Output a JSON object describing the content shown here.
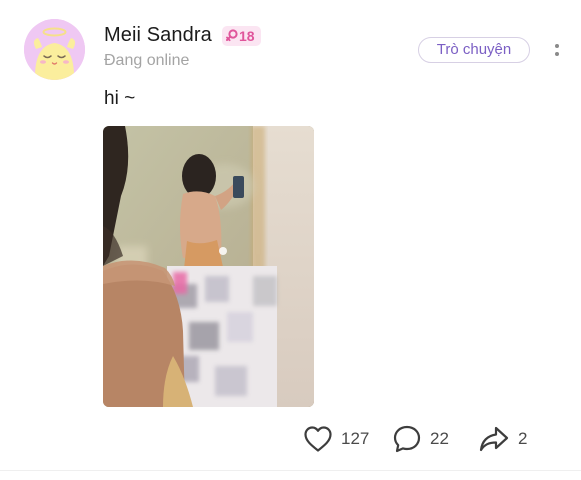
{
  "post": {
    "author": {
      "name": "Meii Sandra",
      "gender_icon": "female-symbol-icon",
      "age_badge": "18",
      "status": "Đang online"
    },
    "chat_button_label": "Trò chuyện",
    "text": "hi ~",
    "actions": {
      "likes": "127",
      "comments": "22",
      "shares": "2"
    }
  },
  "colors": {
    "avatar_bg": "#efc8f3",
    "badge_bg": "#fbe5f2",
    "badge_text": "#e0559b",
    "chat_button_text": "#7b5fc4",
    "status_text": "#a4a4a4"
  }
}
